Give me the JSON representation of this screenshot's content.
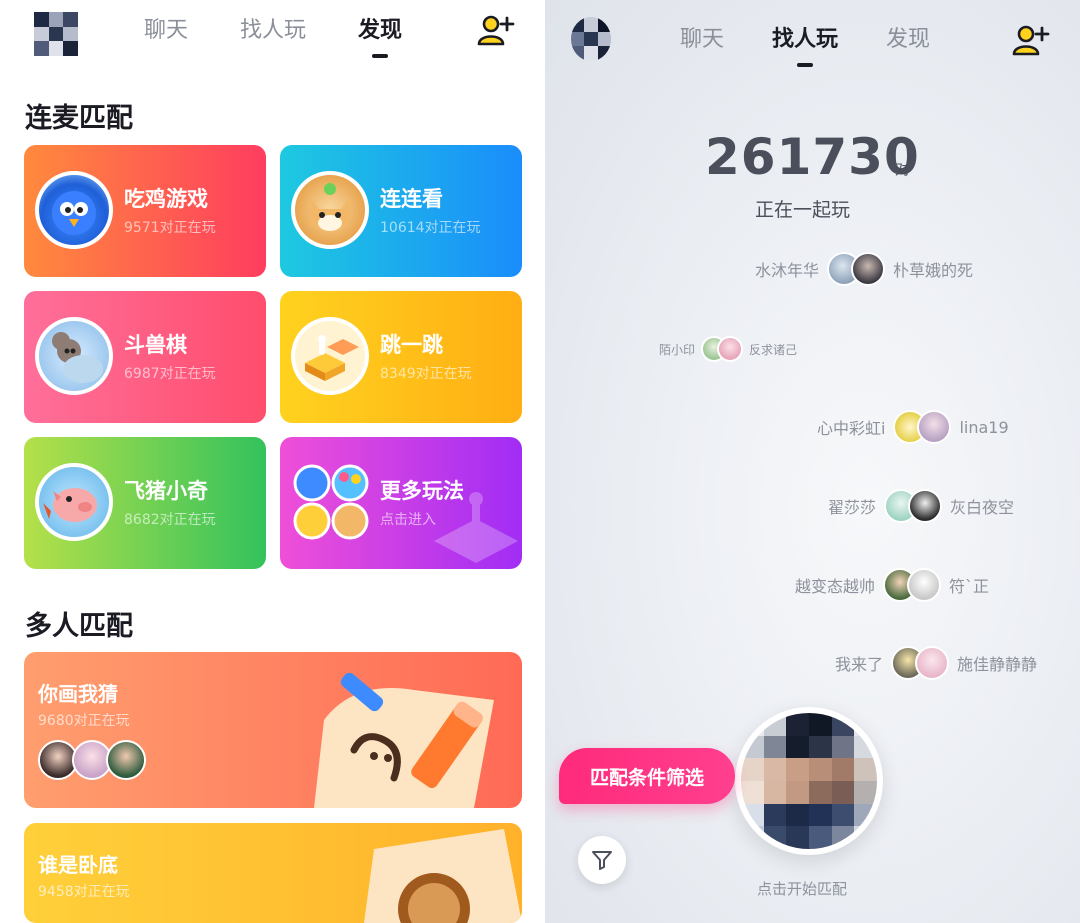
{
  "left": {
    "nav": {
      "tabs": [
        "聊天",
        "找人玩",
        "发现"
      ],
      "active": "发现"
    },
    "add_friend_icon": "add-friend-icon",
    "section1": "连麦匹配",
    "section2": "多人匹配",
    "cards": [
      {
        "name": "吃鸡游戏",
        "sub": "9571对正在玩",
        "colors": [
          "#ff8a3d",
          "#ff3d5f"
        ]
      },
      {
        "name": "连连看",
        "sub": "10614对正在玩",
        "colors": [
          "#1ec9e0",
          "#1a8dfb"
        ]
      },
      {
        "name": "斗兽棋",
        "sub": "6987对正在玩",
        "colors": [
          "#ff6f9a",
          "#ff4d6d"
        ]
      },
      {
        "name": "跳一跳",
        "sub": "8349对正在玩",
        "colors": [
          "#ffd21f",
          "#ffae13"
        ]
      },
      {
        "name": "飞猪小奇",
        "sub": "8682对正在玩",
        "colors": [
          "#b5e04a",
          "#33c25c"
        ]
      },
      {
        "name": "更多玩法",
        "sub": "点击进入",
        "colors": [
          "#ef4fd8",
          "#a12df5"
        ]
      }
    ],
    "big_cards": [
      {
        "name": "你画我猜",
        "sub": "9680对正在玩",
        "colors": [
          "#ff9e6e",
          "#ff6a56"
        ]
      },
      {
        "name": "谁是卧底",
        "sub": "9458对正在玩",
        "colors": [
          "#ffd03a",
          "#ffb12a"
        ]
      }
    ]
  },
  "right": {
    "nav": {
      "tabs": [
        "聊天",
        "找人玩",
        "发现"
      ],
      "active": "找人玩"
    },
    "counter": "261730",
    "counter_unit": "对",
    "counter_label": "正在一起玩",
    "pairs": [
      {
        "a": "水沐年华",
        "b": "朴草娥的死"
      },
      {
        "a": "陌小印",
        "b": "反求诸己"
      },
      {
        "a": "心中彩虹i",
        "b": "lina19"
      },
      {
        "a": "翟莎莎",
        "b": "灰白夜空"
      },
      {
        "a": "越变态越帅",
        "b": "符`正"
      },
      {
        "a": "我来了",
        "b": "施佳静静静"
      }
    ],
    "filter_label": "匹配条件筛选",
    "match_hint": "点击开始匹配"
  }
}
